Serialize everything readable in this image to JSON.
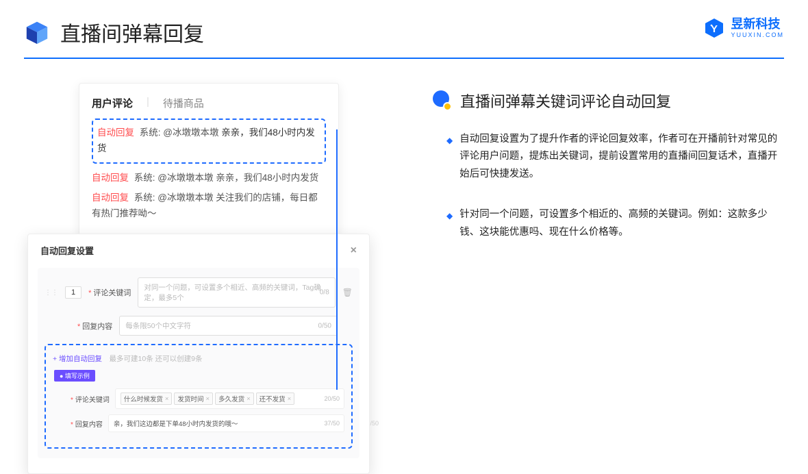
{
  "header": {
    "title": "直播间弹幕回复",
    "logo_main": "昱新科技",
    "logo_sub": "YUUXIN.COM"
  },
  "card1": {
    "tab_active": "用户评论",
    "tab_inactive": "待播商品",
    "highlighted_comment": {
      "tag": "自动回复",
      "sys": "系统:",
      "mention": "@冰墩墩本墩",
      "text": "亲亲，我们48小时内发货"
    },
    "comments": [
      {
        "tag": "自动回复",
        "sys": "系统:",
        "mention": "@冰墩墩本墩",
        "text": "亲亲，我们48小时内发货"
      },
      {
        "tag": "自动回复",
        "sys": "系统:",
        "mention": "@冰墩墩本墩",
        "text": "关注我们的店铺，每日都有热门推荐呦～"
      }
    ]
  },
  "card2": {
    "title": "自动回复设置",
    "order": "1",
    "keyword_label": "评论关键词",
    "keyword_placeholder": "对同一个问题，可设置多个相近、高频的关键词，Tag确定，最多5个",
    "keyword_counter": "0/8",
    "content_label": "回复内容",
    "content_placeholder": "每条限50个中文字符",
    "content_counter": "0/50",
    "add_link": "+ 增加自动回复",
    "add_hint": "最多可建10条 还可以创建9条",
    "example_badge": "● 填写示例",
    "ex_keyword_label": "评论关键词",
    "ex_tags": [
      "什么时候发货",
      "发货时间",
      "多久发货",
      "还不发货"
    ],
    "ex_keyword_counter": "20/50",
    "ex_content_label": "回复内容",
    "ex_content_value": "亲，我们这边都是下单48小时内发货的哦～",
    "ex_content_counter": "37/50",
    "ghost_counter": "/50"
  },
  "right": {
    "section_title": "直播间弹幕关键词评论自动回复",
    "bullets": [
      "自动回复设置为了提升作者的评论回复效率，作者可在开播前针对常见的评论用户问题，提炼出关键词，提前设置常用的直播间回复话术，直播开始后可快捷发送。",
      "针对同一个问题，可设置多个相近的、高频的关键词。例如：这款多少钱、这块能优惠吗、现在什么价格等。"
    ]
  }
}
